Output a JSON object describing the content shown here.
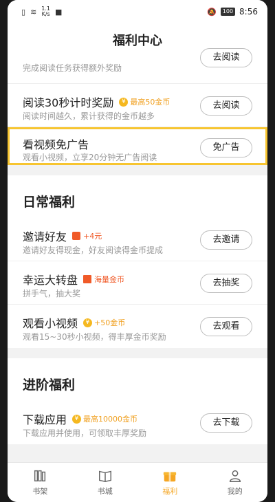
{
  "statusbar": {
    "net_speed_value": "1.1",
    "net_speed_unit": "K/s",
    "battery": "100",
    "time": "8:56"
  },
  "header": {
    "title": "福利中心"
  },
  "tasks_top": [
    {
      "desc": "完成阅读任务获得额外奖励",
      "button": "去阅读"
    },
    {
      "title": "阅读30秒计时奖励",
      "badge": "最高50金币",
      "desc": "阅读时间越久，累计获得的金币越多",
      "button": "去阅读"
    },
    {
      "title": "看视频免广告",
      "desc": "观看小视频，立享20分钟无广告阅读",
      "button": "免广告"
    }
  ],
  "daily": {
    "title": "日常福利",
    "items": [
      {
        "title": "邀请好友",
        "badge": "+4元",
        "desc": "邀请好友得现金，好友阅读得金币提成",
        "button": "去邀请"
      },
      {
        "title": "幸运大转盘",
        "badge": "海量金币",
        "desc": "拼手气，抽大奖",
        "button": "去抽奖"
      },
      {
        "title": "观看小视频",
        "badge": "+50金币",
        "desc": "观看15~30秒小视频，得丰厚金币奖励",
        "button": "去观看"
      }
    ]
  },
  "advanced": {
    "title": "进阶福利",
    "items": [
      {
        "title": "下载应用",
        "badge": "最高10000金币",
        "desc": "下载应用并使用，可领取丰厚奖励",
        "button": "去下载"
      }
    ]
  },
  "tabbar": {
    "tabs": [
      "书架",
      "书城",
      "福利",
      "我的"
    ],
    "active": "福利"
  },
  "colors": {
    "accent": "#f5a623",
    "highlight_border": "#f7c530",
    "coin": "#f5b820",
    "red": "#f05a28"
  }
}
